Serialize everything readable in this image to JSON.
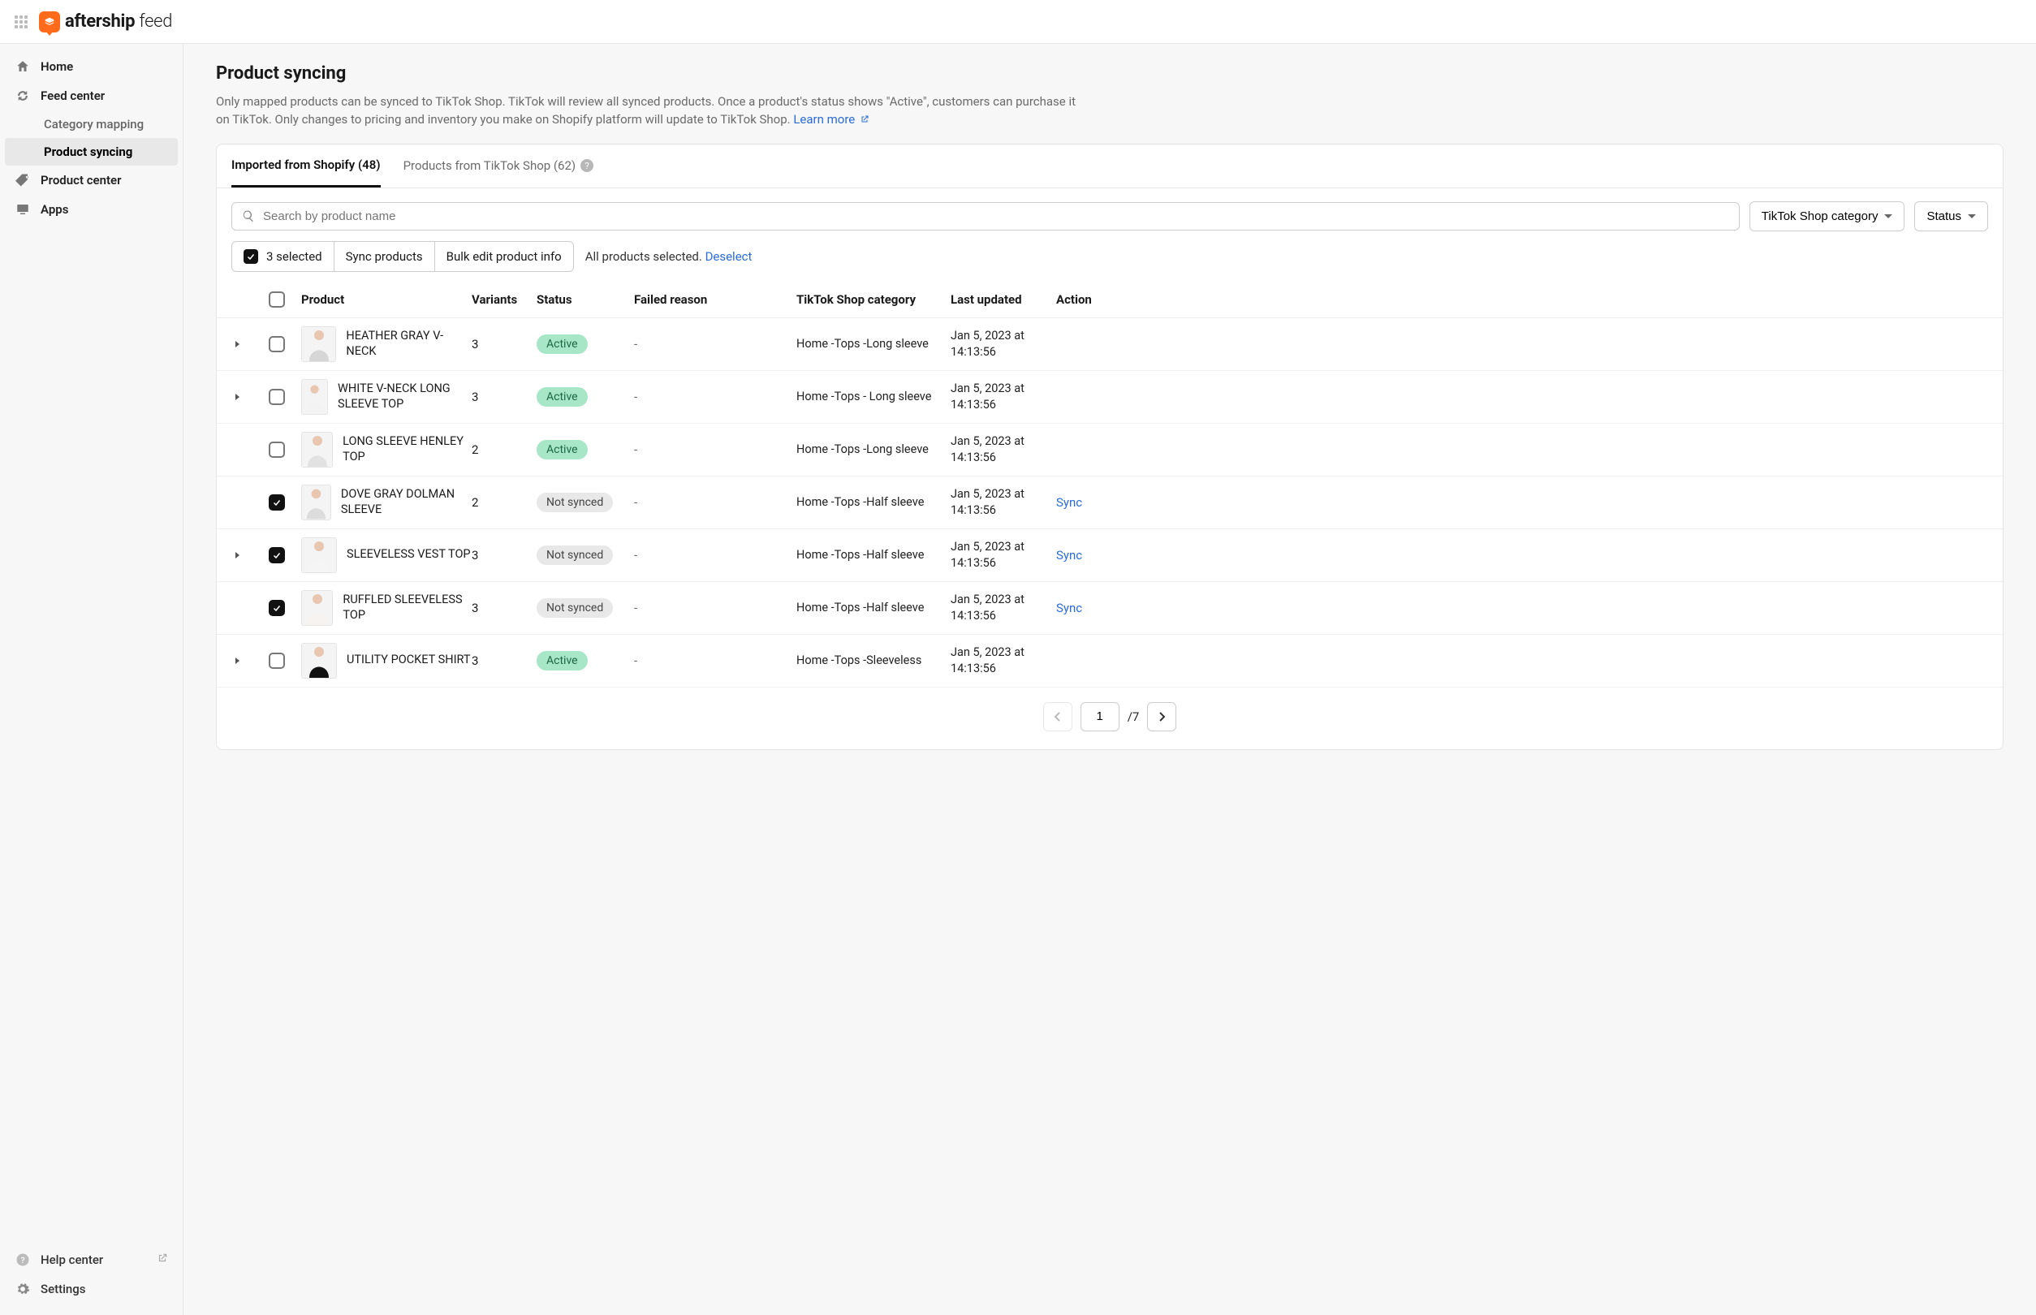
{
  "brand": {
    "name_bold": "aftership",
    "name_light": "feed"
  },
  "sidebar": {
    "items": [
      {
        "label": "Home"
      },
      {
        "label": "Feed center"
      },
      {
        "label": "Category mapping"
      },
      {
        "label": "Product syncing"
      },
      {
        "label": "Product center"
      },
      {
        "label": "Apps"
      }
    ],
    "bottom": [
      {
        "label": "Help center"
      },
      {
        "label": "Settings"
      }
    ]
  },
  "page": {
    "title": "Product syncing",
    "description": "Only mapped products can be synced to TikTok Shop. TikTok will review all synced products. Once a product's status shows \"Active\", customers can purchase it on TikTok. Only changes to pricing and inventory you make on Shopify platform will update to TikTok Shop. ",
    "learn_more": "Learn more"
  },
  "tabs": [
    {
      "label": "Imported from Shopify (48)",
      "active": true
    },
    {
      "label": "Products from TikTok Shop (62)",
      "active": false,
      "help": true
    }
  ],
  "search": {
    "placeholder": "Search by product name"
  },
  "filters": {
    "category": "TikTok Shop category",
    "status": "Status"
  },
  "bulk": {
    "selected_label": "3 selected",
    "sync_label": "Sync products",
    "bulkedit_label": "Bulk edit product info",
    "note_prefix": "All products selected. ",
    "deselect": "Deselect"
  },
  "columns": {
    "product": "Product",
    "variants": "Variants",
    "status": "Status",
    "failed": "Failed reason",
    "category": "TikTok Shop category",
    "updated": "Last updated",
    "action": "Action"
  },
  "rows": [
    {
      "expand": true,
      "checked": false,
      "name": "HEATHER GRAY V-NECK",
      "variants": "3",
      "status": "Active",
      "failed": "-",
      "category": "Home -Tops -Long sleeve",
      "updated": "Jan 5, 2023 at 14:13:56",
      "action": "",
      "thumb": "gray"
    },
    {
      "expand": true,
      "checked": false,
      "name": "WHITE V-NECK LONG SLEEVE TOP",
      "variants": "3",
      "status": "Active",
      "failed": "-",
      "category": "Home -Tops - Long sleeve",
      "updated": "Jan 5, 2023 at 14:13:56",
      "action": "",
      "thumb": "white"
    },
    {
      "expand": false,
      "checked": false,
      "name": "LONG SLEEVE HENLEY TOP",
      "variants": "2",
      "status": "Active",
      "failed": "-",
      "category": "Home -Tops -Long sleeve",
      "updated": "Jan 5, 2023 at 14:13:56",
      "action": "",
      "thumb": "lightgray"
    },
    {
      "expand": false,
      "checked": true,
      "name": "DOVE GRAY DOLMAN SLEEVE",
      "variants": "2",
      "status": "Not synced",
      "failed": "-",
      "category": "Home -Tops -Half sleeve",
      "updated": "Jan 5, 2023 at 14:13:56",
      "action": "Sync",
      "thumb": "dove"
    },
    {
      "expand": true,
      "checked": true,
      "name": "SLEEVELESS VEST TOP",
      "variants": "3",
      "status": "Not synced",
      "failed": "-",
      "category": "Home -Tops -Half sleeve",
      "updated": "Jan 5, 2023 at 14:13:56",
      "action": "Sync",
      "thumb": "vest"
    },
    {
      "expand": false,
      "checked": true,
      "name": "RUFFLED SLEEVELESS TOP",
      "variants": "3",
      "status": "Not synced",
      "failed": "-",
      "category": "Home -Tops -Half sleeve",
      "updated": "Jan 5, 2023 at 14:13:56",
      "action": "Sync",
      "thumb": "ruffle"
    },
    {
      "expand": true,
      "checked": false,
      "name": "UTILITY POCKET SHIRT",
      "variants": "3",
      "status": "Active",
      "failed": "-",
      "category": "Home -Tops -Sleeveless",
      "updated": "Jan 5, 2023 at 14:13:56",
      "action": "",
      "thumb": "black"
    }
  ],
  "pagination": {
    "current": "1",
    "total": "/7"
  }
}
